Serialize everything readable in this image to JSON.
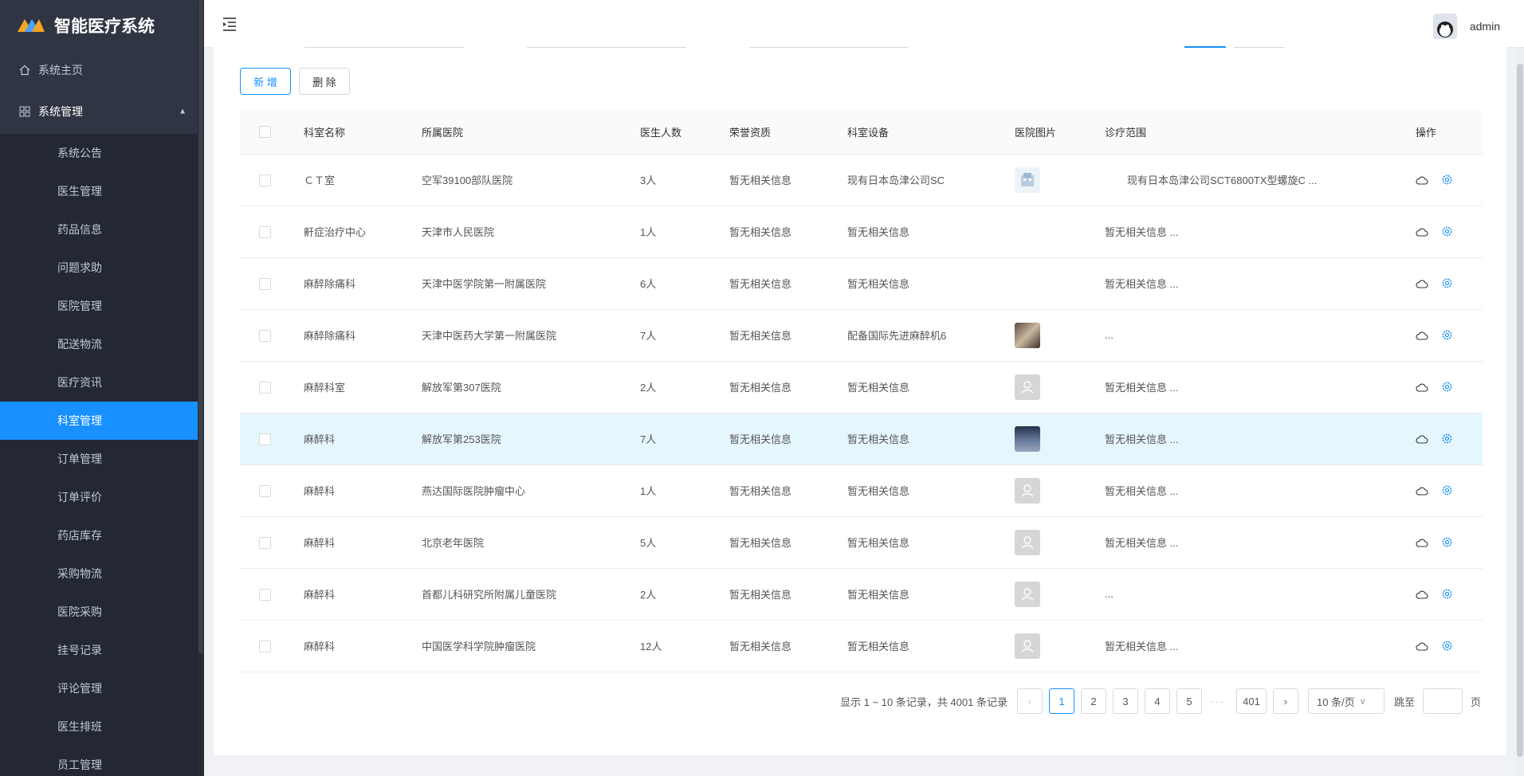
{
  "app": {
    "title": "智能医疗系统"
  },
  "sidebar": {
    "home": "系统主页",
    "group": "系统管理",
    "items": [
      "系统公告",
      "医生管理",
      "药品信息",
      "问题求助",
      "医院管理",
      "配送物流",
      "医疗资讯",
      "科室管理",
      "订单管理",
      "订单评价",
      "药店库存",
      "采购物流",
      "医院采购",
      "挂号记录",
      "评论管理",
      "医生排班",
      "员工管理"
    ],
    "active": "科室管理"
  },
  "header": {
    "username": "admin"
  },
  "toolbar": {
    "add_label": "新 增",
    "delete_label": "删 除"
  },
  "table": {
    "columns": [
      "科室名称",
      "所属医院",
      "医生人数",
      "荣誉资质",
      "科室设备",
      "医院图片",
      "诊疗范围",
      "操作"
    ],
    "rows": [
      {
        "name": "ＣＴ室",
        "hospital": "空军39100部队医院",
        "doctors": "3人",
        "honor": "暂无相关信息",
        "equipment": "现有日本岛津公司SC",
        "image": "sketch",
        "scope": "现有日本岛津公司SCT6800TX型螺旋C ..."
      },
      {
        "name": "鼾症治疗中心",
        "hospital": "天津市人民医院",
        "doctors": "1人",
        "honor": "暂无相关信息",
        "equipment": "暂无相关信息",
        "image": "none",
        "scope": "暂无相关信息 ..."
      },
      {
        "name": "麻醉除痛科",
        "hospital": "天津中医学院第一附属医院",
        "doctors": "6人",
        "honor": "暂无相关信息",
        "equipment": "暂无相关信息",
        "image": "none",
        "scope": "暂无相关信息 ..."
      },
      {
        "name": "麻醉除痛科",
        "hospital": "天津中医药大学第一附属医院",
        "doctors": "7人",
        "honor": "暂无相关信息",
        "equipment": "配备国际先进麻醉机6",
        "image": "photo1",
        "scope": "..."
      },
      {
        "name": "麻醉科室",
        "hospital": "解放军第307医院",
        "doctors": "2人",
        "honor": "暂无相关信息",
        "equipment": "暂无相关信息",
        "image": "placeholder",
        "scope": "暂无相关信息 ..."
      },
      {
        "name": "麻醉科",
        "hospital": "解放军第253医院",
        "doctors": "7人",
        "honor": "暂无相关信息",
        "equipment": "暂无相关信息",
        "image": "photo2",
        "scope": "暂无相关信息 ..."
      },
      {
        "name": "麻醉科",
        "hospital": "燕达国际医院肿瘤中心",
        "doctors": "1人",
        "honor": "暂无相关信息",
        "equipment": "暂无相关信息",
        "image": "placeholder",
        "scope": "暂无相关信息 ..."
      },
      {
        "name": "麻醉科",
        "hospital": "北京老年医院",
        "doctors": "5人",
        "honor": "暂无相关信息",
        "equipment": "暂无相关信息",
        "image": "placeholder",
        "scope": "暂无相关信息 ..."
      },
      {
        "name": "麻醉科",
        "hospital": "首都儿科研究所附属儿童医院",
        "doctors": "2人",
        "honor": "暂无相关信息",
        "equipment": "暂无相关信息",
        "image": "placeholder",
        "scope": "..."
      },
      {
        "name": "麻醉科",
        "hospital": "中国医学科学院肿瘤医院",
        "doctors": "12人",
        "honor": "暂无相关信息",
        "equipment": "暂无相关信息",
        "image": "placeholder",
        "scope": "暂无相关信息 ..."
      }
    ]
  },
  "pagination": {
    "summary": "显示 1 ~ 10 条记录，共 4001 条记录",
    "pages": [
      "1",
      "2",
      "3",
      "4",
      "5"
    ],
    "ellipsis": "···",
    "last": "401",
    "page_size": "10 条/页",
    "jump_label": "跳至",
    "page_suffix": "页"
  },
  "colors": {
    "primary": "#1890ff",
    "sidebar_bg": "#2f3542"
  }
}
